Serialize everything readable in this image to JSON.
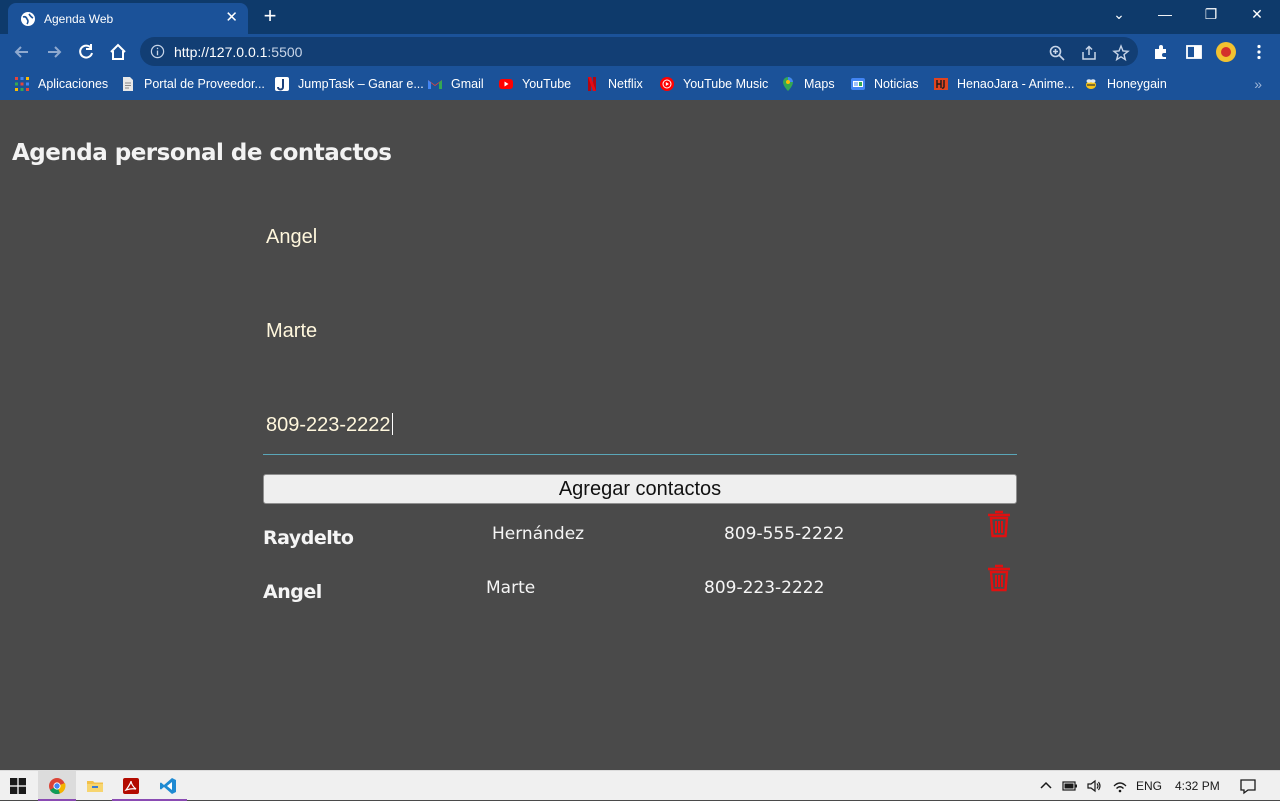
{
  "browser": {
    "tab_title": "Agenda Web",
    "tab_close": "✕",
    "new_tab": "+",
    "url_host": "http://127.0.0.1",
    "url_port": ":5500",
    "window_controls": [
      "⌄",
      "—",
      "❐",
      "✕"
    ],
    "bookmarks": [
      {
        "label": "Aplicaciones",
        "icon": "apps-grid-icon"
      },
      {
        "label": "Portal de Proveedor...",
        "icon": "document-icon"
      },
      {
        "label": "JumpTask – Ganar e...",
        "icon": "jumptask-icon"
      },
      {
        "label": "Gmail",
        "icon": "gmail-icon"
      },
      {
        "label": "YouTube",
        "icon": "youtube-icon"
      },
      {
        "label": "Netflix",
        "icon": "netflix-icon"
      },
      {
        "label": "YouTube Music",
        "icon": "youtube-music-icon"
      },
      {
        "label": "Maps",
        "icon": "maps-icon"
      },
      {
        "label": "Noticias",
        "icon": "news-icon"
      },
      {
        "label": "HenaoJara - Anime...",
        "icon": "henaojara-icon"
      },
      {
        "label": "Honeygain",
        "icon": "honeygain-icon"
      }
    ],
    "bookmarks_more": "»"
  },
  "page": {
    "title": "Agenda personal de contactos",
    "form": {
      "first_name_value": "Angel",
      "last_name_value": "Marte",
      "phone_value": "809-223-2222",
      "submit_label": "Agregar contactos"
    },
    "contacts": [
      {
        "first_name": "Raydelto",
        "last_name": "Hernández",
        "phone": "809-555-2222"
      },
      {
        "first_name": "Angel",
        "last_name": "Marte",
        "phone": "809-223-2222"
      }
    ]
  },
  "taskbar": {
    "language": "ENG",
    "time": "4:32 PM"
  },
  "colors": {
    "tabstrip": "#0e3a6b",
    "toolbar": "#1b5299",
    "page_bg": "#4a4a4a",
    "trash": "#e01010",
    "input_text": "#fff7dd"
  }
}
